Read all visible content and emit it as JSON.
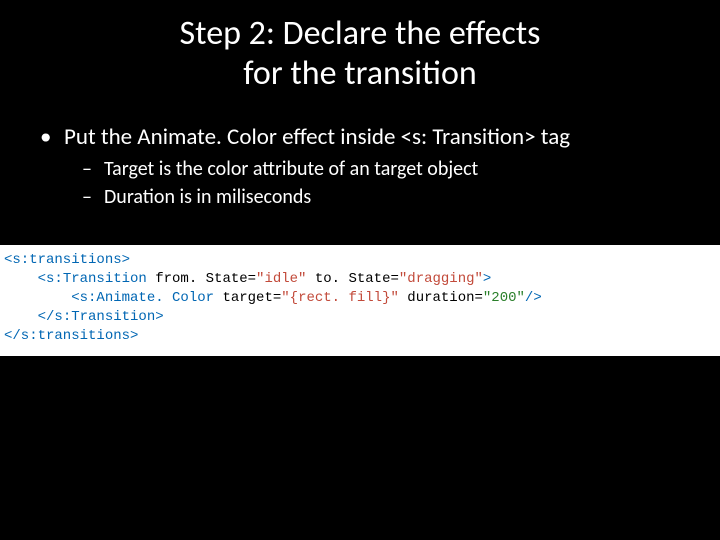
{
  "title": {
    "line1": "Step 2: Declare the effects",
    "line2": "for the transition"
  },
  "bullets": {
    "b1": "Put the Animate. Color effect inside <s: Transition> tag",
    "b2": "Target is the color attribute of an target object",
    "b3": "Duration is in miliseconds"
  },
  "code": {
    "l1_tag": "<s:transitions>",
    "l2_open": "<s:Transition",
    "l2_a1": " from. State=",
    "l2_v1": "\"idle\"",
    "l2_a2": " to. State=",
    "l2_v2": "\"dragging\"",
    "l2_close": ">",
    "l3_open": "<s:Animate. Color",
    "l3_a1": " target=",
    "l3_v1": "\"{rect. fill}\"",
    "l3_a2": " duration=",
    "l3_v2": "\"200\"",
    "l3_close": "/>",
    "l4": "</s:Transition>",
    "l5": "</s:transitions>",
    "ind1": "    ",
    "ind2": "        "
  }
}
